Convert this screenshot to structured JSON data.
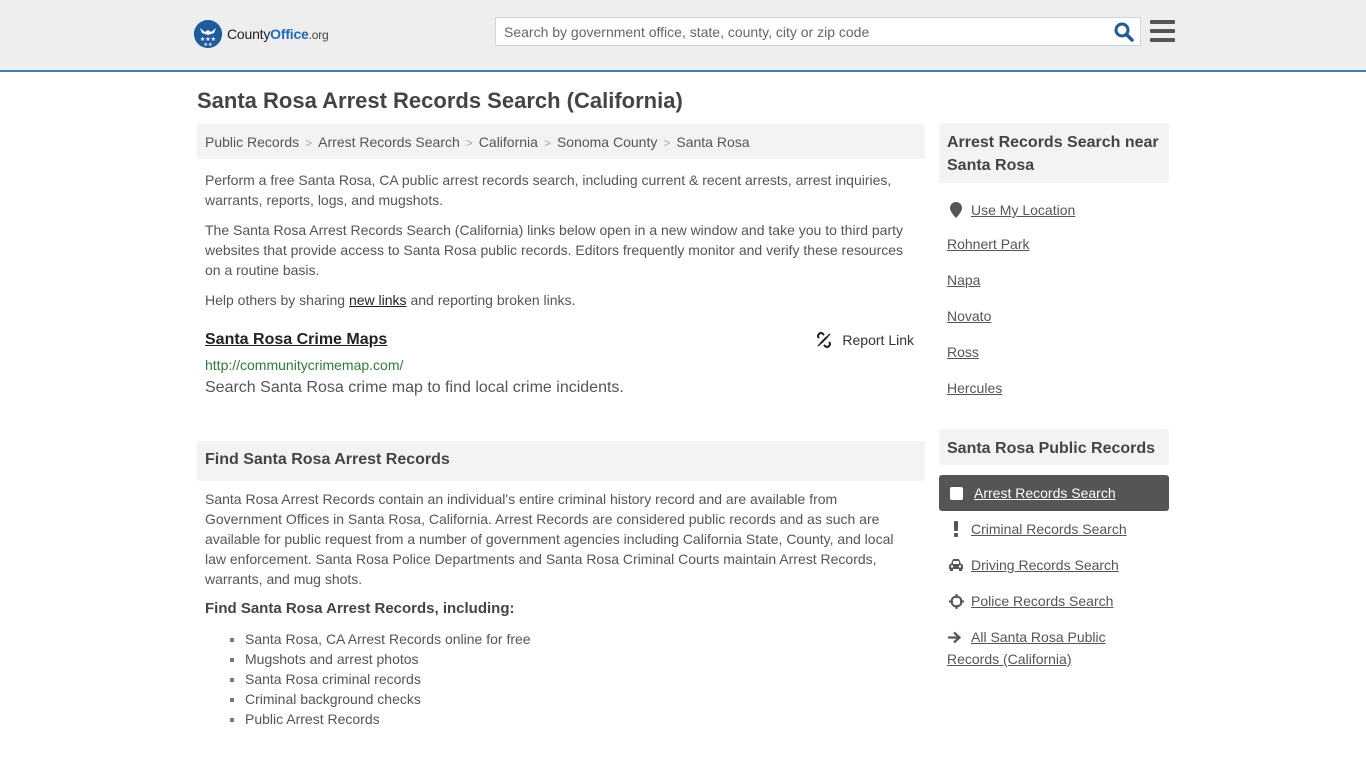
{
  "header": {
    "logo": {
      "county": "County",
      "office": "Office",
      "org": ".org",
      "icon": "eagle-stars-badge"
    },
    "search": {
      "placeholder": "Search by government office, state, county, city or zip code",
      "value": ""
    },
    "search_icon": "magnifier-icon",
    "menu_icon": "hamburger-icon",
    "accent_color": "#3a7fb4"
  },
  "page": {
    "title": "Santa Rosa Arrest Records Search (California)",
    "breadcrumb": [
      "Public Records",
      "Arrest Records Search",
      "California",
      "Sonoma County",
      "Santa Rosa"
    ],
    "intro": "Perform a free Santa Rosa, CA public arrest records search, including current & recent arrests, arrest inquiries, warrants, reports, logs, and mugshots.",
    "disclaimer": "The Santa Rosa Arrest Records Search (California) links below open in a new window and take you to third party websites that provide access to Santa Rosa public records. Editors frequently monitor and verify these resources on a routine basis.",
    "share": {
      "before": "Help others by sharing ",
      "link": "new links",
      "after": " and reporting broken links."
    }
  },
  "results": [
    {
      "title": "Santa Rosa Crime Maps",
      "url": "http://communitycrimemap.com/",
      "description": "Search Santa Rosa crime map to find local crime incidents.",
      "report_label": "Report Link"
    }
  ],
  "find_section": {
    "heading": "Find Santa Rosa Arrest Records",
    "body": "Santa Rosa Arrest Records contain an individual's entire criminal history record and are available from Government Offices in Santa Rosa, California. Arrest Records are considered public records and as such are available for public request from a number of government agencies including California State, County, and local law enforcement. Santa Rosa Police Departments and Santa Rosa Criminal Courts maintain Arrest Records, warrants, and mug shots.",
    "subheading": "Find Santa Rosa Arrest Records, including:",
    "bullets": [
      "Santa Rosa, CA Arrest Records online for free",
      "Mugshots and arrest photos",
      "Santa Rosa criminal records",
      "Criminal background checks",
      "Public Arrest Records"
    ]
  },
  "sidebar": {
    "nearby": {
      "heading": "Arrest Records Search near Santa Rosa",
      "use_location": "Use My Location",
      "cities": [
        "Rohnert Park",
        "Napa",
        "Novato",
        "Ross",
        "Hercules"
      ]
    },
    "public_records": {
      "heading": "Santa Rosa Public Records",
      "items": [
        {
          "label": "Arrest Records Search",
          "icon": "square-icon",
          "active": true
        },
        {
          "label": "Criminal Records Search",
          "icon": "exclamation-icon",
          "active": false
        },
        {
          "label": "Driving Records Search",
          "icon": "car-icon",
          "active": false
        },
        {
          "label": "Police Records Search",
          "icon": "crosshair-icon",
          "active": false
        }
      ],
      "all_link": "All Santa Rosa Public Records (California)"
    }
  }
}
